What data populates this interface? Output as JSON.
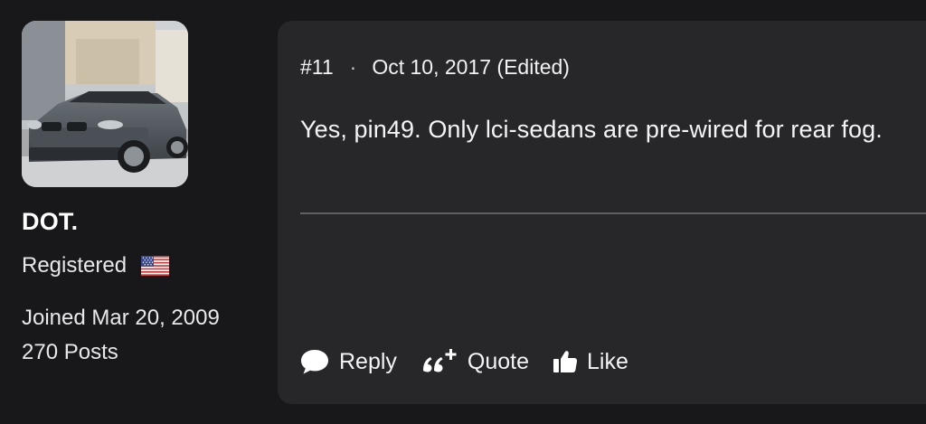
{
  "user": {
    "name": "DOT.",
    "role": "Registered",
    "joined": "Joined Mar 20, 2009",
    "posts": "270 Posts",
    "avatar_icon": "car-avatar",
    "flag_icon": "us-flag-icon"
  },
  "post": {
    "number": "#11",
    "separator": "·",
    "date": "Oct 10, 2017 (Edited)",
    "body": "Yes, pin49. Only lci-sedans are pre-wired for rear fog."
  },
  "actions": {
    "reply_label": "Reply",
    "quote_label": "Quote",
    "like_label": "Like"
  },
  "colors": {
    "background": "#18181b",
    "card": "#27272a",
    "text": "#ffffff",
    "divider": "#5f5f64"
  }
}
